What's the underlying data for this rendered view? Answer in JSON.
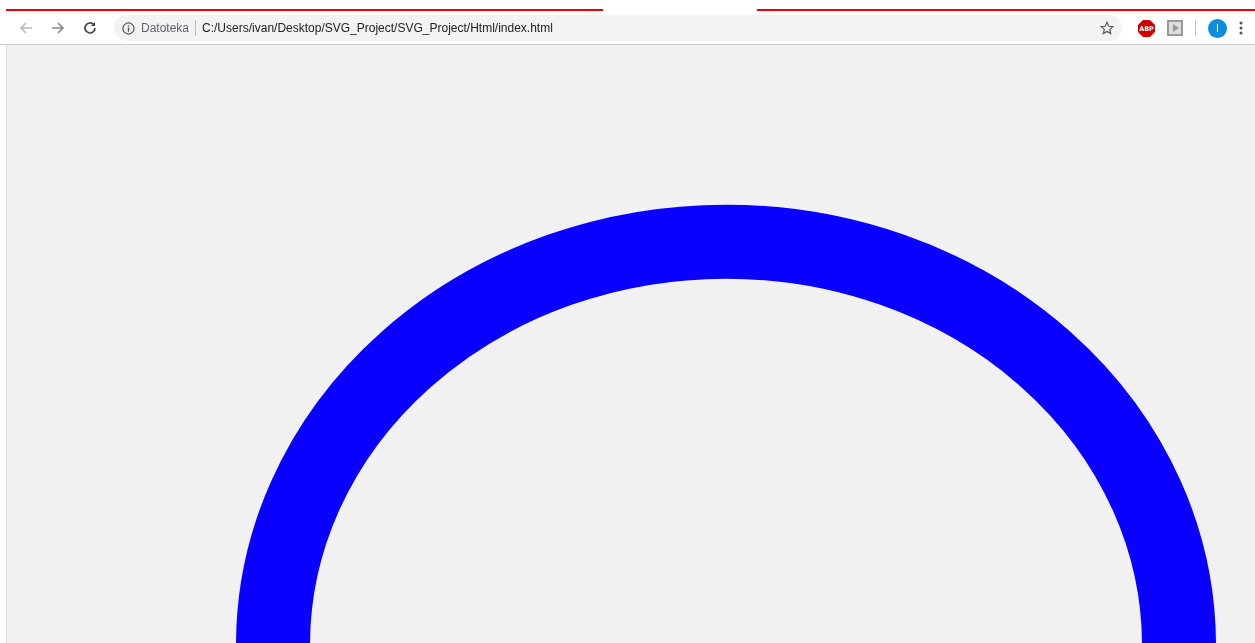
{
  "toolbar": {
    "security_label": "Datoteka",
    "url": "C:/Users/ivan/Desktop/SVG_Project/SVG_Project/Html/index.html",
    "adblock_label": "ABP",
    "profile_initial": "I"
  }
}
